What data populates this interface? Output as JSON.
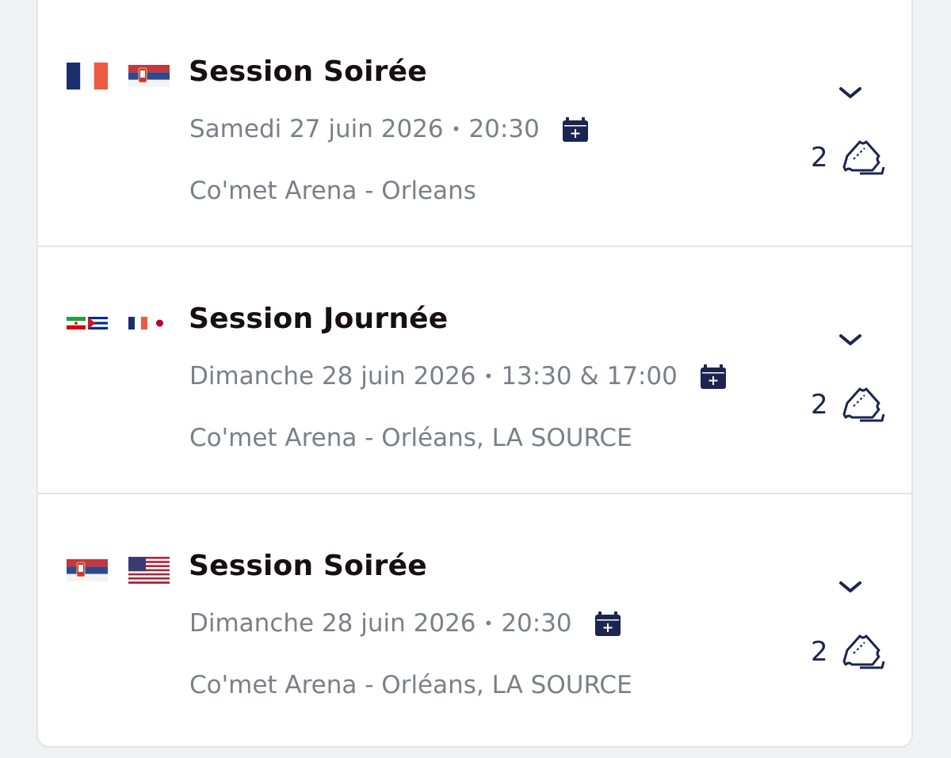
{
  "sessions": [
    {
      "flags": [
        "france-flag",
        "serbia-flag"
      ],
      "title": "Session Soirée",
      "date": "Samedi 27 juin 2026",
      "separator": "•",
      "time": "20:30",
      "location": "Co'met Arena - Orleans",
      "ticket_count": "2"
    },
    {
      "flags": [
        "iran-cuba-flags",
        "france-japan-flags"
      ],
      "title": "Session Journée",
      "date": "Dimanche 28 juin 2026",
      "separator": "•",
      "time": "13:30 & 17:00",
      "location": "Co'met Arena - Orléans, LA SOURCE",
      "ticket_count": "2"
    },
    {
      "flags": [
        "serbia-flag",
        "usa-flag"
      ],
      "title": "Session Soirée",
      "date": "Dimanche 28 juin 2026",
      "separator": "•",
      "time": "20:30",
      "location": "Co'met Arena - Orléans, LA SOURCE",
      "ticket_count": "2"
    }
  ],
  "colors": {
    "accent": "#1c2450",
    "title": "#170f12",
    "muted": "#7b7f88",
    "divider": "#e2e4e8",
    "background": "#f1f2f4"
  }
}
